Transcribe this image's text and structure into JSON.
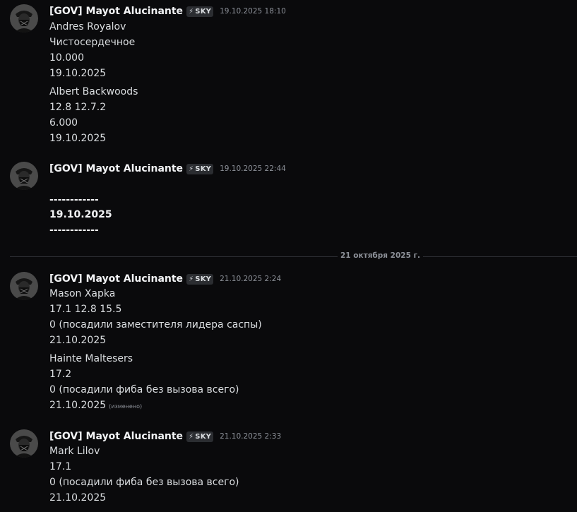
{
  "messages": [
    {
      "username": "[GOV] Mayot Alucinante",
      "tag_icon": "⚡",
      "tag": "SKY",
      "timestamp": "19.10.2025 18:10",
      "lines": [
        "Andres Royalov",
        "Чистосердечное",
        "10.000",
        "19.10.2025",
        "Albert Backwoods",
        "12.8 12.7.2",
        "6.000",
        "19.10.2025"
      ]
    },
    {
      "username": "[GOV] Mayot Alucinante",
      "tag_icon": "⚡",
      "tag": "SKY",
      "timestamp": "19.10.2025 22:44",
      "lines": [
        "------------",
        "19.10.2025",
        "------------"
      ]
    },
    {
      "username": "[GOV] Mayot Alucinante",
      "tag_icon": "⚡",
      "tag": "SKY",
      "timestamp": "21.10.2025 2:24",
      "lines": [
        "Mason Xapka",
        "17.1 12.8 15.5",
        "0 (посадили заместителя лидера саспы)",
        "21.10.2025",
        "Hainte Maltesers",
        "17.2",
        "0 (посадили фиба без вызова всего)",
        "21.10.2025"
      ],
      "edited": "(изменено)"
    },
    {
      "username": "[GOV] Mayot Alucinante",
      "tag_icon": "⚡",
      "tag": "SKY",
      "timestamp": "21.10.2025 2:33",
      "lines": [
        "Mark Lilov",
        "17.1",
        "0 (посадили фиба без вызова всего)",
        "21.10.2025"
      ]
    }
  ],
  "date_divider": "21 октября 2025 г."
}
